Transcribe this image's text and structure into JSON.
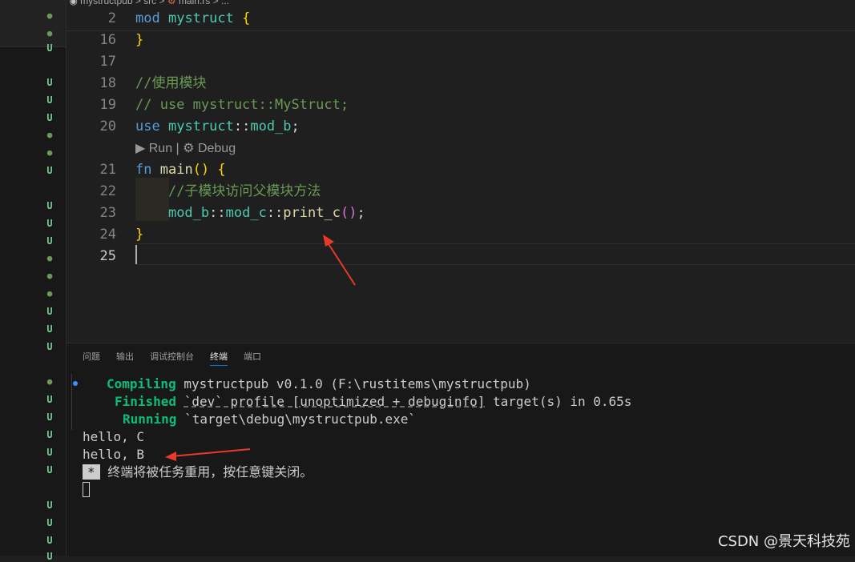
{
  "breadcrumb": {
    "path": "mystructpub > src > ",
    "file": "main.rs > ..."
  },
  "editor": {
    "lines": [
      {
        "num": "2",
        "tokens": [
          [
            "kw",
            "mod"
          ],
          [
            "pl",
            " "
          ],
          [
            "md",
            "mystruct"
          ],
          [
            "pl",
            " "
          ],
          [
            "br1",
            "{"
          ]
        ]
      },
      {
        "num": "16",
        "tokens": [
          [
            "br1",
            "}"
          ]
        ]
      },
      {
        "num": "17",
        "tokens": []
      },
      {
        "num": "18",
        "tokens": [
          [
            "cm",
            "//使用模块"
          ]
        ]
      },
      {
        "num": "19",
        "tokens": [
          [
            "cm",
            "// use mystruct::MyStruct;"
          ]
        ]
      },
      {
        "num": "20",
        "tokens": [
          [
            "kw",
            "use"
          ],
          [
            "pl",
            " "
          ],
          [
            "md",
            "mystruct"
          ],
          [
            "pl",
            "::"
          ],
          [
            "md",
            "mod_b"
          ],
          [
            "pl",
            ";"
          ]
        ]
      },
      {
        "num": "21",
        "tokens": [
          [
            "kw",
            "fn"
          ],
          [
            "pl",
            " "
          ],
          [
            "fnn",
            "main"
          ],
          [
            "br1",
            "()"
          ],
          [
            "pl",
            " "
          ],
          [
            "br1",
            "{"
          ]
        ]
      },
      {
        "num": "22",
        "tokens": [
          [
            "pl",
            "    "
          ],
          [
            "cm",
            "//子模块访问父模块方法"
          ]
        ]
      },
      {
        "num": "23",
        "tokens": [
          [
            "pl",
            "    "
          ],
          [
            "md",
            "mod_b"
          ],
          [
            "pl",
            "::"
          ],
          [
            "md",
            "mod_c"
          ],
          [
            "pl",
            "::"
          ],
          [
            "fnn",
            "print_c"
          ],
          [
            "br2",
            "()"
          ],
          [
            "pl",
            ";"
          ]
        ]
      },
      {
        "num": "24",
        "tokens": [
          [
            "br1",
            "}"
          ]
        ]
      },
      {
        "num": "25",
        "tokens": []
      }
    ],
    "active_line": "25",
    "codelens": "▶ Run | ⚙ Debug"
  },
  "panel": {
    "tabs": [
      "问题",
      "输出",
      "调试控制台",
      "终端",
      "端口"
    ],
    "active_tab": "终端",
    "terminal": {
      "compiling_label": "Compiling",
      "compiling_text": " mystructpub v0.1.0 (F:\\rustitems\\mystructpub)",
      "finished_label": "Finished",
      "finished_pre": " ",
      "finished_dashed": "`dev` profile [unoptimized + debuginfo]",
      "finished_post": " target(s) in 0.65s",
      "running_label": "Running",
      "running_text": " `target\\debug\\mystructpub.exe`",
      "out1": "hello, C",
      "out2": "hello, B",
      "marker": "*",
      "notice": "终端将被任务重用，按任意键关闭。"
    }
  },
  "gutter_marks": [
    {
      "t": "dot"
    },
    {
      "t": "dot"
    },
    {
      "t": "U"
    },
    {
      "t": "U"
    },
    {
      "t": "U"
    },
    {
      "t": "U"
    },
    {
      "t": "dot"
    },
    {
      "t": "dot"
    },
    {
      "t": "U"
    },
    {
      "t": "U"
    },
    {
      "t": "U"
    },
    {
      "t": "U"
    },
    {
      "t": "dot"
    },
    {
      "t": "dot"
    },
    {
      "t": "dot"
    },
    {
      "t": "U"
    },
    {
      "t": "U"
    },
    {
      "t": "U"
    },
    {
      "t": "dot"
    },
    {
      "t": "U"
    },
    {
      "t": "U"
    },
    {
      "t": "U"
    },
    {
      "t": "U"
    },
    {
      "t": "U"
    },
    {
      "t": "U"
    },
    {
      "t": "U"
    },
    {
      "t": "U"
    },
    {
      "t": "U"
    }
  ],
  "watermark": "CSDN @景天科技苑",
  "colors": {
    "accent": "#0078d4",
    "arrow": "#e8392b",
    "git_untracked": "#73c991"
  }
}
